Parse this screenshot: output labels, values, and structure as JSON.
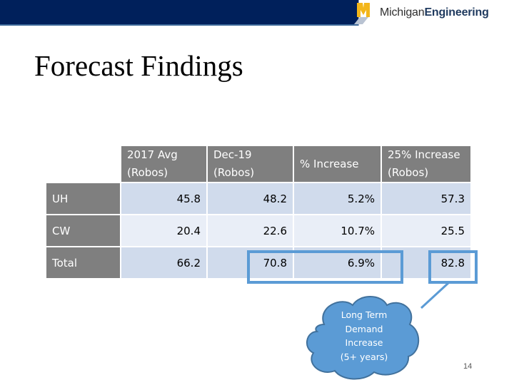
{
  "header": {
    "logo_text_light": "Michigan",
    "logo_text_bold": "Engineering",
    "brand_color": "#00205b"
  },
  "slide": {
    "title": "Forecast Findings",
    "page_number": "14"
  },
  "table": {
    "columns": [
      "2017 Avg (Robos)",
      "Dec-19 (Robos)",
      "% Increase",
      "25% Increase (Robos)"
    ],
    "rows": [
      {
        "label": "UH",
        "values": [
          "45.8",
          "48.2",
          "5.2%",
          "57.3"
        ]
      },
      {
        "label": "CW",
        "values": [
          "20.4",
          "22.6",
          "10.7%",
          "25.5"
        ]
      },
      {
        "label": "Total",
        "values": [
          "66.2",
          "70.8",
          "6.9%",
          "82.8"
        ]
      }
    ]
  },
  "callout": {
    "lines": [
      "Long Term",
      "Demand",
      "Increase",
      "(5+ years)"
    ],
    "color": "#5b9bd5"
  }
}
